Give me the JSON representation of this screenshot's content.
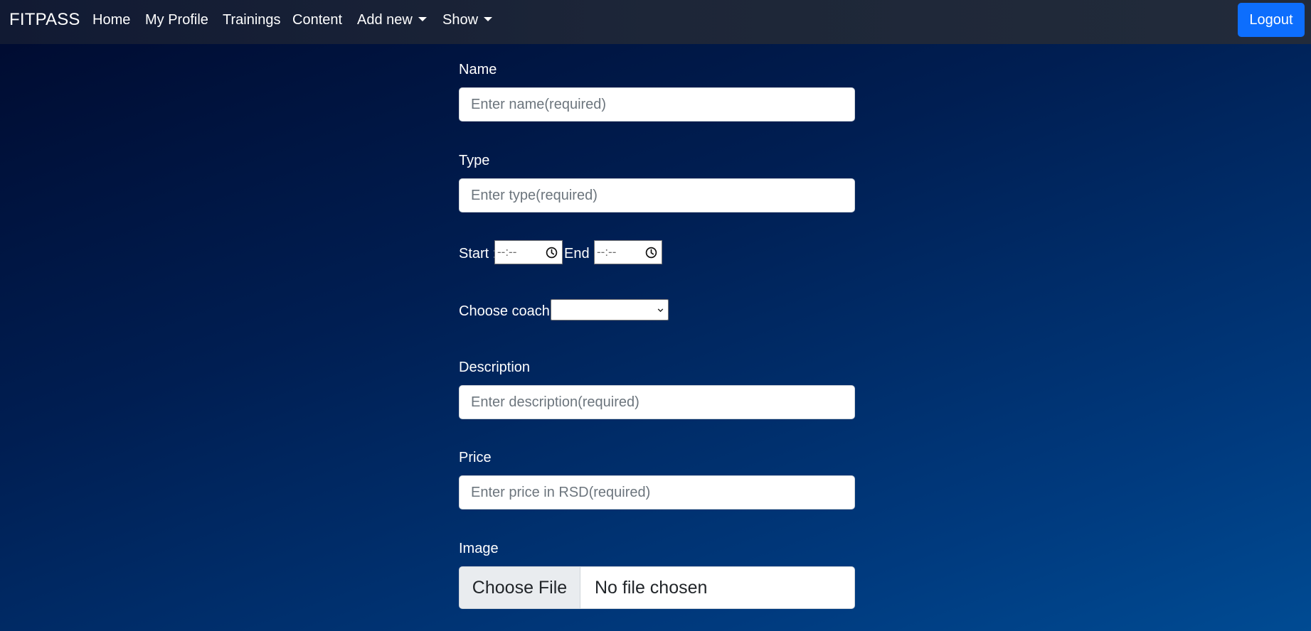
{
  "navbar": {
    "brand": "FITPASS",
    "items": [
      {
        "label": "Home"
      },
      {
        "label": "My Profile"
      },
      {
        "label": "Trainings"
      },
      {
        "label": "Content"
      },
      {
        "label": "Add new",
        "dropdown": true
      },
      {
        "label": "Show",
        "dropdown": true
      }
    ],
    "logout_label": "Logout"
  },
  "form": {
    "name": {
      "label": "Name",
      "placeholder": "Enter name(required)",
      "value": ""
    },
    "type": {
      "label": "Type",
      "placeholder": "Enter type(required)",
      "value": ""
    },
    "time": {
      "start_label": "Start :",
      "start_value": "--:--",
      "end_label": "End :",
      "end_value": "--:--",
      "icon": "clock-icon"
    },
    "coach": {
      "label": "Choose coach:",
      "selected": ""
    },
    "description": {
      "label": "Description",
      "placeholder": "Enter description(required)",
      "value": ""
    },
    "price": {
      "label": "Price",
      "placeholder": "Enter price in RSD(required)",
      "value": ""
    },
    "image": {
      "label": "Image",
      "button_label": "Choose File",
      "status": "No file chosen"
    }
  },
  "colors": {
    "navbar_bg": "#1d2638",
    "logout_bg": "#0d6efd",
    "page_bg_start": "#000a2e",
    "page_bg_end": "#004b93"
  }
}
